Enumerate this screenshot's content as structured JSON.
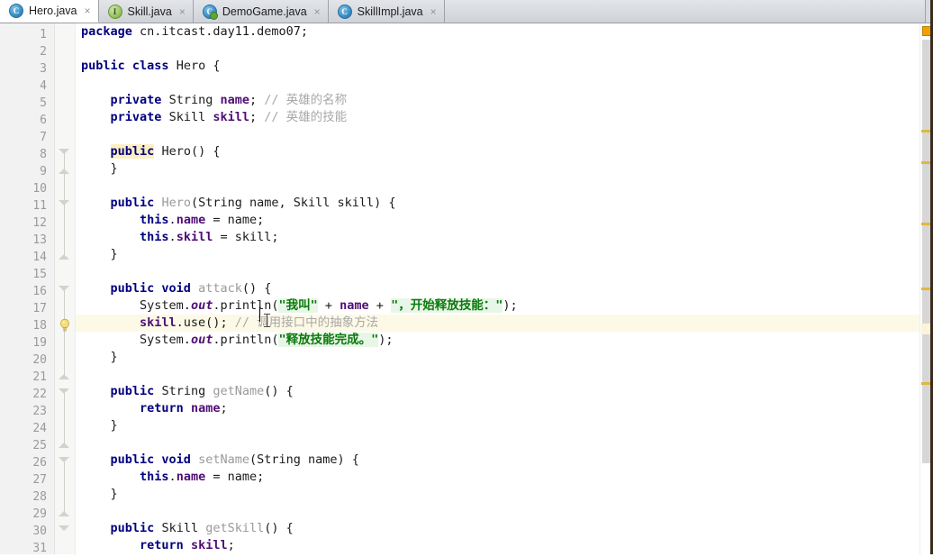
{
  "window": {
    "app": "IntelliJ IDEA Java Editor",
    "active_file": "Hero.java"
  },
  "tabs": [
    {
      "label": "Hero.java",
      "icon": "java-class-icon",
      "active": true,
      "close": "×"
    },
    {
      "label": "Skill.java",
      "icon": "java-interface-icon",
      "active": false,
      "close": "×"
    },
    {
      "label": "DemoGame.java",
      "icon": "java-runnable-class-icon",
      "active": false,
      "close": "×"
    },
    {
      "label": "SkillImpl.java",
      "icon": "java-class-icon",
      "active": false,
      "close": "×"
    }
  ],
  "editor": {
    "first_line": 1,
    "last_line": 31,
    "caret_line": 18,
    "highlighted_token": "public",
    "gutter_icon_line_18": "intention-bulb-icon",
    "line_numbers": [
      1,
      2,
      3,
      4,
      5,
      6,
      7,
      8,
      9,
      10,
      11,
      12,
      13,
      14,
      15,
      16,
      17,
      18,
      19,
      20,
      21,
      22,
      23,
      24,
      25,
      26,
      27,
      28,
      29,
      30,
      31
    ],
    "lines": [
      {
        "n": 1,
        "text": "package cn.itcast.day11.demo07;"
      },
      {
        "n": 2,
        "text": ""
      },
      {
        "n": 3,
        "text": "public class Hero {"
      },
      {
        "n": 4,
        "text": ""
      },
      {
        "n": 5,
        "text": "    private String name; // 英雄的名称"
      },
      {
        "n": 6,
        "text": "    private Skill skill; // 英雄的技能"
      },
      {
        "n": 7,
        "text": ""
      },
      {
        "n": 8,
        "text": "    public Hero() {"
      },
      {
        "n": 9,
        "text": "    }"
      },
      {
        "n": 10,
        "text": ""
      },
      {
        "n": 11,
        "text": "    public Hero(String name, Skill skill) {"
      },
      {
        "n": 12,
        "text": "        this.name = name;"
      },
      {
        "n": 13,
        "text": "        this.skill = skill;"
      },
      {
        "n": 14,
        "text": "    }"
      },
      {
        "n": 15,
        "text": ""
      },
      {
        "n": 16,
        "text": "    public void attack() {"
      },
      {
        "n": 17,
        "text": "        System.out.println(\"我叫\" + name + \"，开始释放技能：\");"
      },
      {
        "n": 18,
        "text": "        skill.use(); // 调用接口中的抽象方法"
      },
      {
        "n": 19,
        "text": "        System.out.println(\"释放技能完成。\");"
      },
      {
        "n": 20,
        "text": "    }"
      },
      {
        "n": 21,
        "text": ""
      },
      {
        "n": 22,
        "text": "    public String getName() {"
      },
      {
        "n": 23,
        "text": "        return name;"
      },
      {
        "n": 24,
        "text": "    }"
      },
      {
        "n": 25,
        "text": ""
      },
      {
        "n": 26,
        "text": "    public void setName(String name) {"
      },
      {
        "n": 27,
        "text": "        this.name = name;"
      },
      {
        "n": 28,
        "text": "    }"
      },
      {
        "n": 29,
        "text": ""
      },
      {
        "n": 30,
        "text": "    public Skill getSkill() {"
      },
      {
        "n": 31,
        "text": "        return skill;"
      }
    ],
    "comments": [
      "英雄的名称",
      "英雄的技能",
      "调用接口中的抽象方法"
    ],
    "strings": [
      "我叫",
      "，开始释放技能：",
      "释放技能完成。"
    ]
  },
  "markers": {
    "status": "warning",
    "status_color": "#f0a000",
    "warning_color": "#e0b83a",
    "positions": [
      145,
      180,
      248,
      320,
      360,
      425
    ]
  },
  "colors": {
    "keyword": "#00007f",
    "field": "#4f0e75",
    "string": "#0a7a0a",
    "comment": "#a8a8a8",
    "method": "#9a9a9a",
    "caret_line_bg": "#fcf9e6",
    "gutter_bg": "#f2f2f2",
    "editor_bg": "#ffffff"
  }
}
